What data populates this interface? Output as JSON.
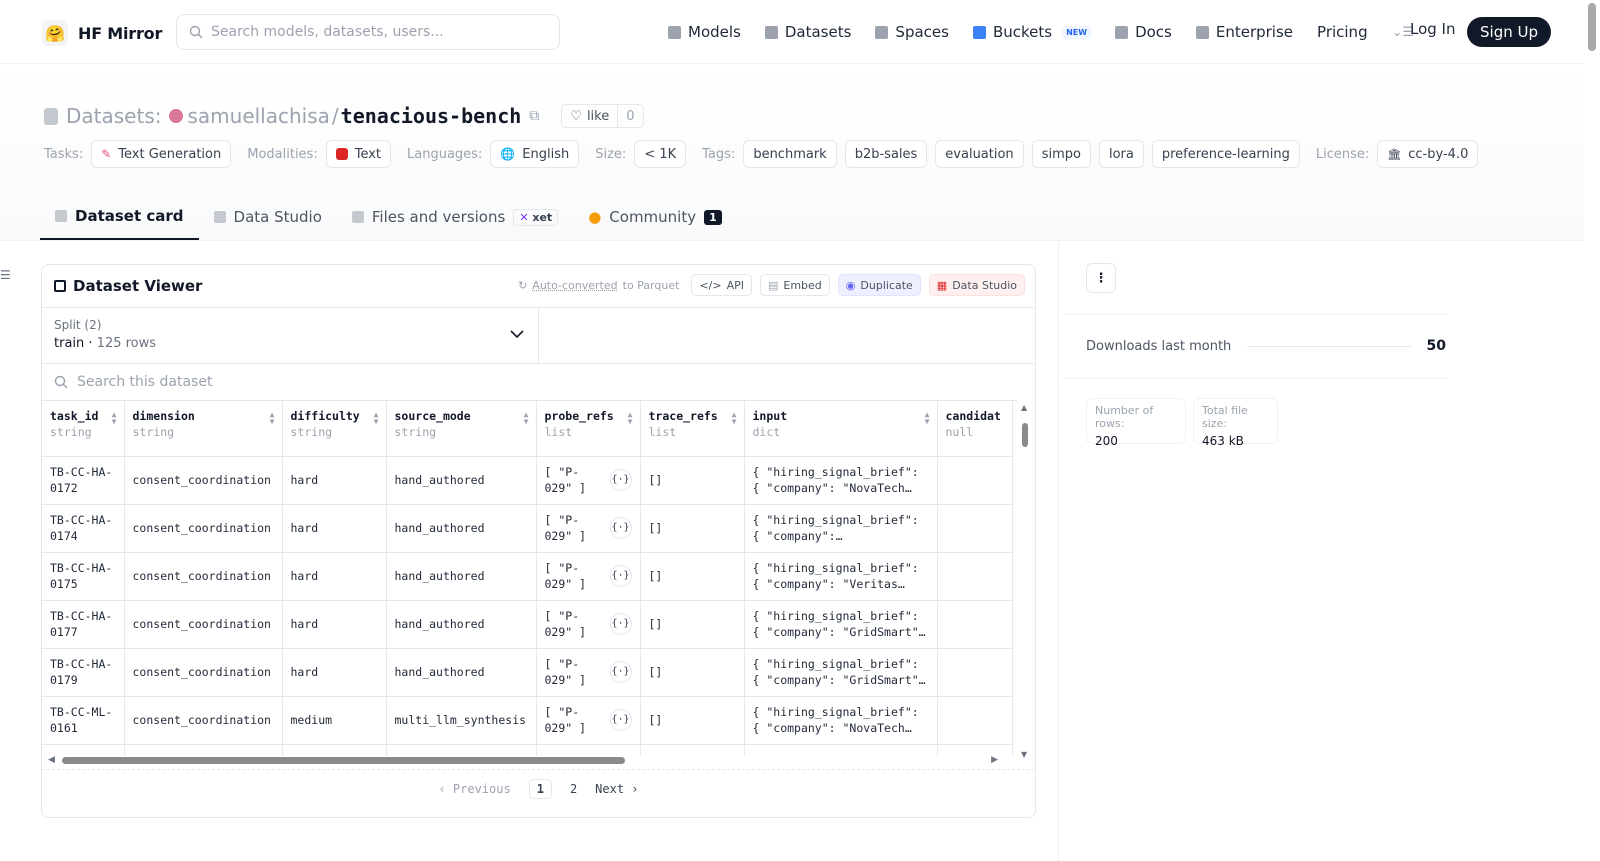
{
  "nav": {
    "brand": "HF Mirror",
    "search_placeholder": "Search models, datasets, users...",
    "items": [
      {
        "label": "Models",
        "icon": "cube-icon"
      },
      {
        "label": "Datasets",
        "icon": "database-icon"
      },
      {
        "label": "Spaces",
        "icon": "grid-icon"
      },
      {
        "label": "Buckets",
        "icon": "bucket-icon",
        "badge": "NEW"
      },
      {
        "label": "Docs",
        "icon": "book-icon"
      },
      {
        "label": "Enterprise",
        "icon": "enterprise-icon"
      },
      {
        "label": "Pricing"
      }
    ],
    "login": "Log In",
    "signup": "Sign Up"
  },
  "header": {
    "section": "Datasets:",
    "owner": "samuellachisa",
    "sep": "/",
    "name": "tenacious-bench",
    "like_label": "like",
    "like_count": "0",
    "tags_label": {
      "tasks": "Tasks:",
      "modalities": "Modalities:",
      "languages": "Languages:",
      "size": "Size:",
      "tags": "Tags:",
      "license": "License:"
    },
    "task": "Text Generation",
    "modality": "Text",
    "language": "English",
    "size": "< 1K",
    "tags": [
      "benchmark",
      "b2b-sales",
      "evaluation",
      "simpo",
      "lora",
      "preference-learning"
    ],
    "license": "cc-by-4.0"
  },
  "tabs": {
    "card": "Dataset card",
    "studio": "Data Studio",
    "files": "Files and versions",
    "xet": "xet",
    "community": "Community",
    "community_count": "1"
  },
  "viewer": {
    "title": "Dataset Viewer",
    "autoconv_a": "Auto-converted",
    "autoconv_b": "to Parquet",
    "api": "API",
    "embed": "Embed",
    "duplicate": "Duplicate",
    "data_studio": "Data Studio",
    "split_label": "Split (2)",
    "split_name": "train",
    "split_rows": "125 rows",
    "search_placeholder": "Search this dataset",
    "columns": [
      {
        "name": "task_id",
        "type": "string"
      },
      {
        "name": "dimension",
        "type": "string"
      },
      {
        "name": "difficulty",
        "type": "string"
      },
      {
        "name": "source_mode",
        "type": "string"
      },
      {
        "name": "probe_refs",
        "type": "list"
      },
      {
        "name": "trace_refs",
        "type": "list"
      },
      {
        "name": "input",
        "type": "dict"
      },
      {
        "name": "candidat",
        "type": "null"
      }
    ],
    "rows": [
      {
        "task_id": "TB-CC-HA-0172",
        "dimension": "consent_coordination",
        "difficulty": "hard",
        "source_mode": "hand_authored",
        "probe_refs": "[ \"P-029\" ]",
        "trace_refs": "[]",
        "input_a": "{ \"hiring_signal_brief\":",
        "input_b": "{ \"company\": \"NovaTech…"
      },
      {
        "task_id": "TB-CC-HA-0174",
        "dimension": "consent_coordination",
        "difficulty": "hard",
        "source_mode": "hand_authored",
        "probe_refs": "[ \"P-029\" ]",
        "trace_refs": "[]",
        "input_a": "{ \"hiring_signal_brief\":",
        "input_b": "{ \"company\":…"
      },
      {
        "task_id": "TB-CC-HA-0175",
        "dimension": "consent_coordination",
        "difficulty": "hard",
        "source_mode": "hand_authored",
        "probe_refs": "[ \"P-029\" ]",
        "trace_refs": "[]",
        "input_a": "{ \"hiring_signal_brief\":",
        "input_b": "{ \"company\": \"Veritas…"
      },
      {
        "task_id": "TB-CC-HA-0177",
        "dimension": "consent_coordination",
        "difficulty": "hard",
        "source_mode": "hand_authored",
        "probe_refs": "[ \"P-029\" ]",
        "trace_refs": "[]",
        "input_a": "{ \"hiring_signal_brief\":",
        "input_b": "{ \"company\": \"GridSmart\"…"
      },
      {
        "task_id": "TB-CC-HA-0179",
        "dimension": "consent_coordination",
        "difficulty": "hard",
        "source_mode": "hand_authored",
        "probe_refs": "[ \"P-029\" ]",
        "trace_refs": "[]",
        "input_a": "{ \"hiring_signal_brief\":",
        "input_b": "{ \"company\": \"GridSmart\"…"
      },
      {
        "task_id": "TB-CC-ML-0161",
        "dimension": "consent_coordination",
        "difficulty": "medium",
        "source_mode": "multi_llm_synthesis",
        "probe_refs": "[ \"P-029\" ]",
        "trace_refs": "[]",
        "input_a": "{ \"hiring_signal_brief\":",
        "input_b": "{ \"company\": \"NovaTech…"
      },
      {
        "task_id": "TB-CC-ML-",
        "dimension": "",
        "difficulty": "",
        "source_mode": "",
        "probe_refs": "[ \"P-",
        "trace_refs": "",
        "input_a": "{ \"hiring_signal_brief\":",
        "input_b": ""
      }
    ],
    "pager": {
      "prev": "Previous",
      "p1": "1",
      "p2": "2",
      "next": "Next"
    }
  },
  "sidebar": {
    "more": "⋮",
    "downloads_label": "Downloads last month",
    "downloads_value": "50",
    "rows_label": "Number of rows:",
    "rows_value": "200",
    "size_label": "Total file size:",
    "size_value": "463 kB"
  }
}
